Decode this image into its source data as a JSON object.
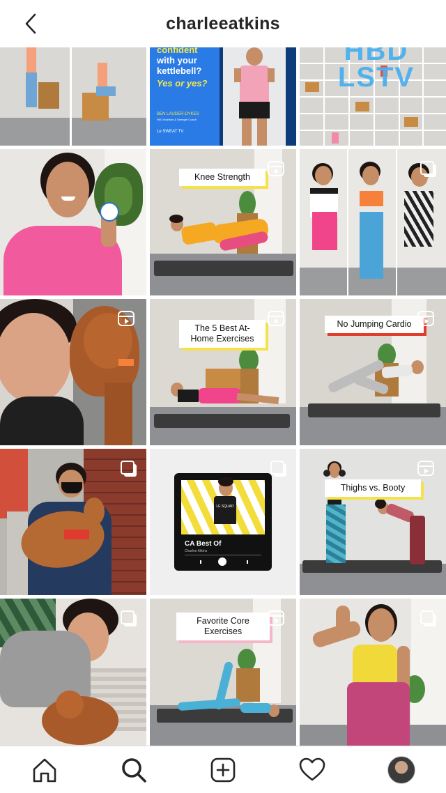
{
  "header": {
    "title": "charleeatkins",
    "back_icon": "chevron-left-icon"
  },
  "colors": {
    "text": "#262626",
    "yellow": "#f5e24a",
    "red": "#e33c2e",
    "pink": "#f5b6c8",
    "blue": "#1a73e8"
  },
  "tiles": {
    "t2": {
      "line1": "confident",
      "line2": "with your",
      "line3": "kettlebell?",
      "line4": "Yes or yes?",
      "coach": "BEN LAUDER-DYKES",
      "coach_role": "HIIO Nutrition & Strength Coach",
      "brand": "Le SWEAT TV"
    },
    "t3": {
      "overlay": "HBD LSTV"
    },
    "t5": {
      "label": "Knee Strength"
    },
    "t8": {
      "label": "The 5 Best At-Home Exercises"
    },
    "t9": {
      "label": "No Jumping Cardio"
    },
    "t11": {
      "album_title": "CA Best Of",
      "album_sub": "Charlee Atkins",
      "shirt": "LE SQUAD"
    },
    "t12": {
      "label": "Thighs vs. Booty"
    },
    "t14": {
      "label": "Favorite Core Exercises"
    }
  },
  "nav": [
    "home-icon",
    "search-icon",
    "new-post-icon",
    "activity-heart-icon",
    "profile-avatar"
  ]
}
